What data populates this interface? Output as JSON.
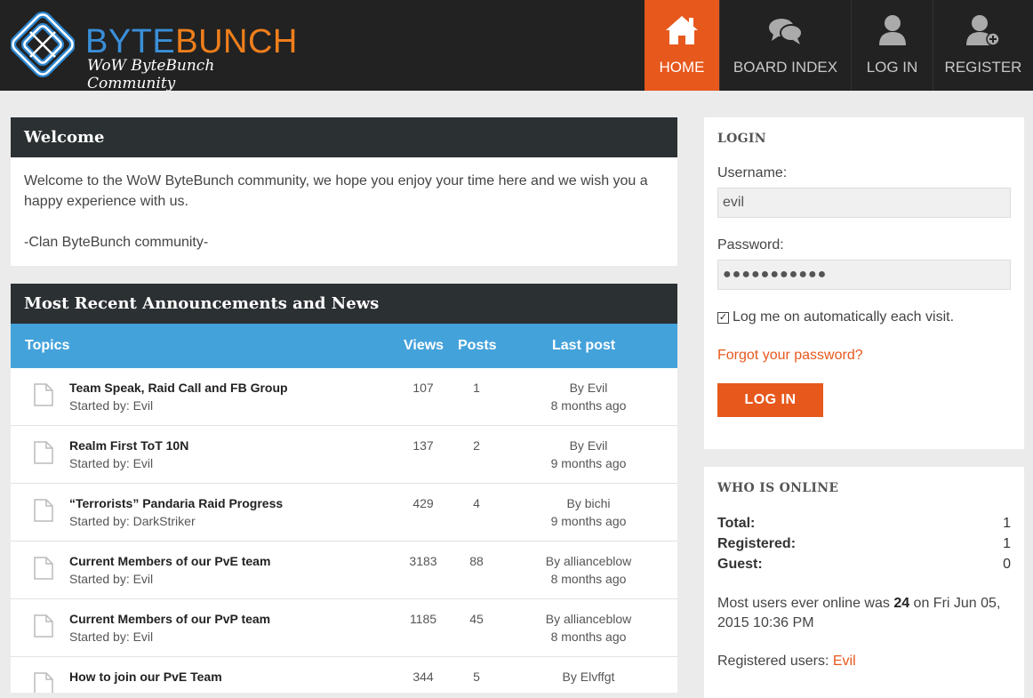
{
  "brand": {
    "name_part1": "BYTE",
    "name_part2": "BUNCH",
    "tagline": "WoW ByteBunch Community",
    "colors": {
      "byte": "#3a8fd9",
      "bunch": "#f07f1b"
    }
  },
  "nav": {
    "items": [
      {
        "label": "HOME",
        "icon": "home-icon",
        "active": true
      },
      {
        "label": "BOARD INDEX",
        "icon": "chat-bubbles-icon",
        "active": false
      },
      {
        "label": "LOG IN",
        "icon": "user-icon",
        "active": false
      },
      {
        "label": "REGISTER",
        "icon": "user-add-icon",
        "active": false
      }
    ],
    "active_color": "#e7581d"
  },
  "welcome": {
    "title": "Welcome",
    "text": "Welcome to the WoW ByteBunch community, we hope you enjoy your time here and we wish you a happy experience with us.",
    "signature": "-Clan ByteBunch community-"
  },
  "news": {
    "title": "Most Recent Announcements and News",
    "columns": {
      "topics": "Topics",
      "views": "Views",
      "posts": "Posts",
      "last_post": "Last post"
    },
    "header_color": "#44a2db",
    "rows": [
      {
        "title": "Team Speak, Raid Call and FB Group",
        "started_by": "Started by: Evil",
        "views": "107",
        "posts": "1",
        "by": "By Evil",
        "ago": "8 months ago"
      },
      {
        "title": "Realm First ToT 10N",
        "started_by": "Started by: Evil",
        "views": "137",
        "posts": "2",
        "by": "By Evil",
        "ago": "9 months ago"
      },
      {
        "title": "“Terrorists” Pandaria Raid Progress",
        "started_by": "Started by: DarkStriker",
        "views": "429",
        "posts": "4",
        "by": "By bichi",
        "ago": "9 months ago"
      },
      {
        "title": "Current Members of our PvE team",
        "started_by": "Started by: Evil",
        "views": "3183",
        "posts": "88",
        "by": "By allianceblow",
        "ago": "8 months ago"
      },
      {
        "title": "Current Members of our PvP team",
        "started_by": "Started by: Evil",
        "views": "1185",
        "posts": "45",
        "by": "By allianceblow",
        "ago": "8 months ago"
      },
      {
        "title": "How to join our PvE Team",
        "started_by": "",
        "views": "344",
        "posts": "5",
        "by": "By Elvffgt",
        "ago": ""
      }
    ]
  },
  "login": {
    "title": "LOGIN",
    "username_label": "Username:",
    "username_value": "evil",
    "password_label": "Password:",
    "password_value": "●●●●●●●●●●●",
    "remember_label": "Log me on automatically each visit.",
    "remember_checked": true,
    "forgot_label": "Forgot your password?",
    "button_label": "LOG IN"
  },
  "online": {
    "title": "WHO IS ONLINE",
    "stats": [
      {
        "label": "Total:",
        "value": "1"
      },
      {
        "label": "Registered:",
        "value": "1"
      },
      {
        "label": "Guest:",
        "value": "0"
      }
    ],
    "record_prefix": "Most users ever online was ",
    "record_count": "24",
    "record_suffix": " on Fri Jun 05, 2015 10:36 PM",
    "registered_prefix": "Registered users: ",
    "registered_user": "Evil"
  }
}
